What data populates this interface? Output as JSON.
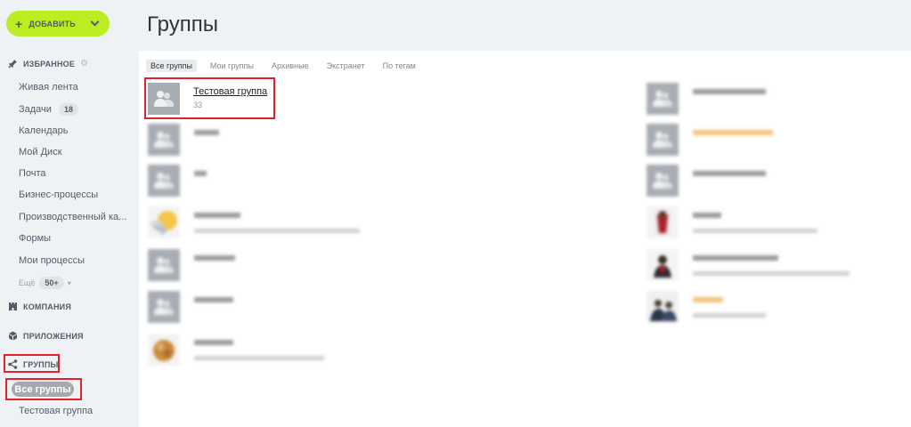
{
  "sidebar": {
    "add_button": "ДОБАВИТЬ",
    "favorites": {
      "label": "ИЗБРАННОЕ"
    },
    "items": [
      {
        "label": "Живая лента"
      },
      {
        "label": "Задачи",
        "badge": "18"
      },
      {
        "label": "Календарь"
      },
      {
        "label": "Мой Диск"
      },
      {
        "label": "Почта"
      },
      {
        "label": "Бизнес-процессы"
      },
      {
        "label": "Производственный ка..."
      },
      {
        "label": "Формы"
      },
      {
        "label": "Мои процессы"
      }
    ],
    "more": {
      "label": "Ещё",
      "badge": "50+"
    },
    "company": "КОМПАНИЯ",
    "apps": "ПРИЛОЖЕНИЯ",
    "groups": "ГРУППЫ",
    "all_groups": "Все группы",
    "test_group": "Тестовая группа"
  },
  "main": {
    "title": "Группы",
    "tabs": [
      "Все группы",
      "Мои группы",
      "Архивные",
      "Экстранет",
      "По тегам"
    ],
    "highlighted_group": {
      "name": "Тестовая группа",
      "members": "33"
    }
  },
  "colors": {
    "accent_green": "#bbed21",
    "highlight_red": "#e3212a"
  }
}
